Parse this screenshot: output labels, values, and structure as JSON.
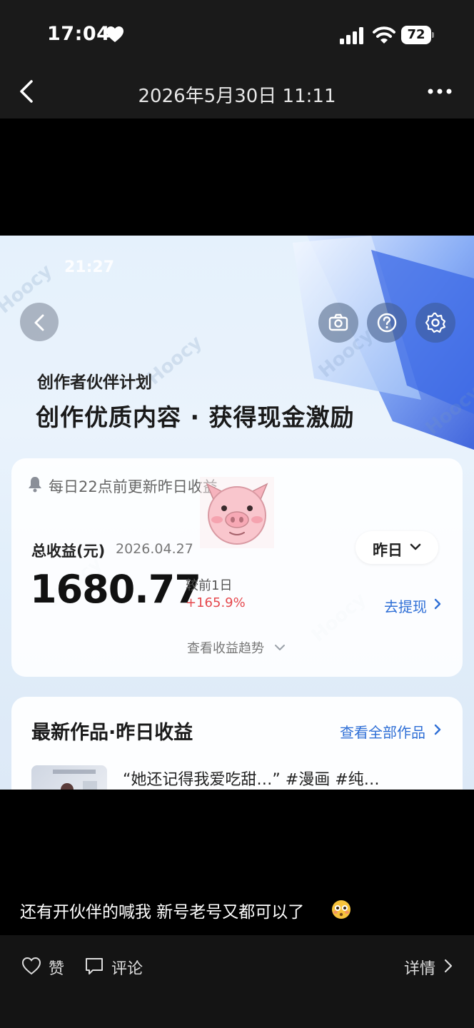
{
  "status_bar": {
    "time": "17:04",
    "battery": "72",
    "icons": [
      "heart-icon",
      "signal-icon",
      "wifi-icon",
      "battery-icon"
    ]
  },
  "nav": {
    "title": "2026年5月30日 11:11",
    "icons": [
      "back-chevron-icon",
      "more-dots-icon"
    ]
  },
  "post_image": {
    "phone_time": "21:27",
    "watermark": "Hoocy",
    "plan_title": "创作者伙伴计划",
    "slogan": "创作优质内容 · 获得现金激励",
    "notice": "每日22点前更新昨日收益",
    "earnings": {
      "label": "总收益(元)",
      "date": "2026.04.27",
      "amount": "1680.77",
      "period_button": "昨日",
      "compare_label": "较前1日",
      "compare_pct": "+165.9%",
      "withdraw": "去提现",
      "trend": "查看收益趋势"
    },
    "latest": {
      "title": "最新作品·昨日收益",
      "view_all": "查看全部作品",
      "items": [
        {
          "title": "“她还记得我爱吃甜…” #漫画 #纯…"
        }
      ]
    },
    "colors": {
      "accent_blue": "#2f6fd6",
      "increase_red": "#e5484d"
    }
  },
  "caption": {
    "text": "还有开伙伴的喊我 新号老号又都可以了",
    "emoji": "flushed-face-emoji"
  },
  "actions": {
    "like": "赞",
    "comment": "评论",
    "detail": "详情"
  }
}
